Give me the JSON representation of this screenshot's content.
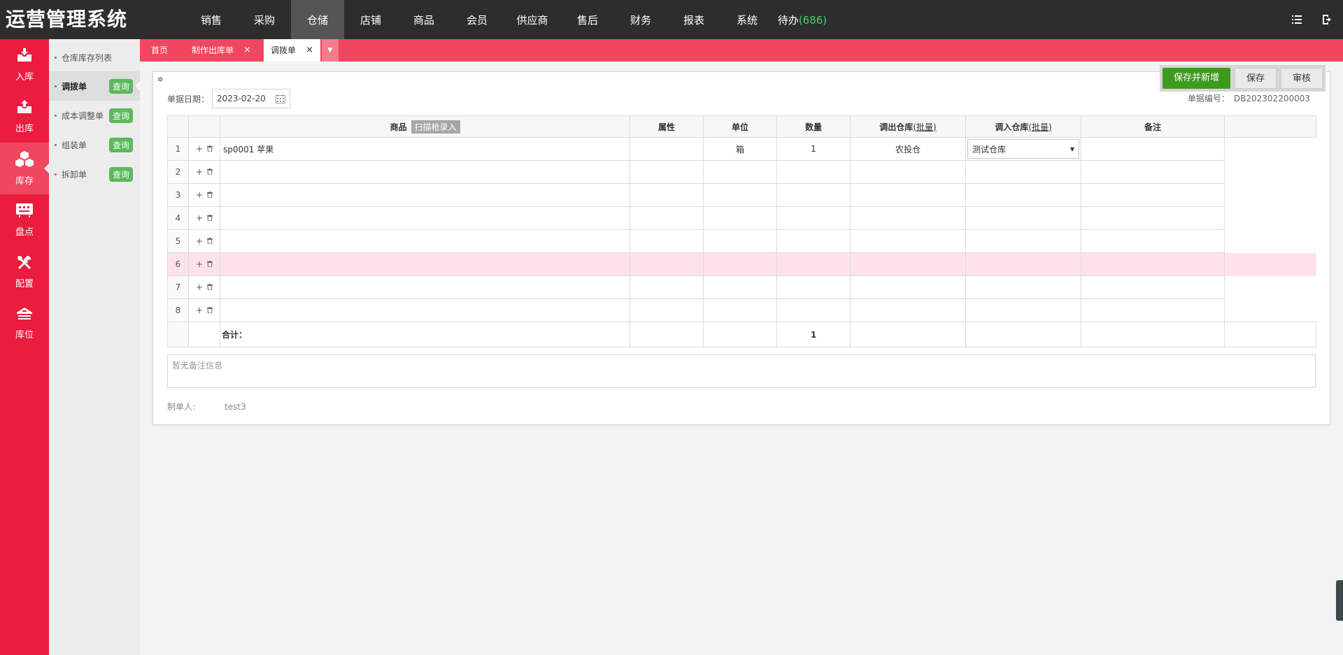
{
  "app": {
    "title": "运营管理系统"
  },
  "topnav": [
    {
      "label": "销售"
    },
    {
      "label": "采购"
    },
    {
      "label": "仓储",
      "active": true
    },
    {
      "label": "店铺"
    },
    {
      "label": "商品"
    },
    {
      "label": "会员"
    },
    {
      "label": "供应商"
    },
    {
      "label": "售后"
    },
    {
      "label": "财务"
    },
    {
      "label": "报表"
    },
    {
      "label": "系统"
    }
  ],
  "todo": {
    "label": "待办",
    "count": "(686)"
  },
  "sidebar": [
    {
      "label": "入库",
      "icon": "inbox-in-icon"
    },
    {
      "label": "出库",
      "icon": "inbox-out-icon"
    },
    {
      "label": "库存",
      "icon": "boxes-icon",
      "active": true
    },
    {
      "label": "盘点",
      "icon": "count-icon"
    },
    {
      "label": "配置",
      "icon": "tools-icon"
    },
    {
      "label": "库位",
      "icon": "warehouse-icon"
    }
  ],
  "submenu": [
    {
      "label": "仓库库存列表"
    },
    {
      "label": "调拨单",
      "tag": "查询",
      "active": true
    },
    {
      "label": "成本调整单",
      "tag": "查询"
    },
    {
      "label": "组装单",
      "tag": "查询"
    },
    {
      "label": "拆卸单",
      "tag": "查询"
    }
  ],
  "tabs": [
    {
      "label": "首页"
    },
    {
      "label": "制作出库单",
      "close": "×"
    },
    {
      "label": "调拨单",
      "close": "×",
      "active": true
    }
  ],
  "form": {
    "date_label": "单据日期：",
    "date_value": "2023-02-20",
    "docno_label": "单据编号：",
    "docno_value": "DB202302200003",
    "buttons": {
      "save_new": "保存并新增",
      "save": "保存",
      "audit": "审核"
    }
  },
  "grid": {
    "headers": {
      "product": "商品",
      "scan": "扫描枪录入",
      "attr": "属性",
      "unit": "单位",
      "qty": "数量",
      "out_wh": "调出仓库",
      "in_wh": "调入仓库",
      "batch": "(批量)",
      "remark": "备注"
    },
    "rows": [
      {
        "no": "1",
        "product": "sp0001 苹果",
        "attr": "",
        "unit": "箱",
        "qty": "1",
        "out_wh": "农投仓",
        "in_wh": "测试仓库",
        "remark": ""
      },
      {
        "no": "2",
        "product": "",
        "attr": "",
        "unit": "",
        "qty": "",
        "out_wh": "",
        "in_wh": "",
        "remark": ""
      },
      {
        "no": "3",
        "product": "",
        "attr": "",
        "unit": "",
        "qty": "",
        "out_wh": "",
        "in_wh": "",
        "remark": ""
      },
      {
        "no": "4",
        "product": "",
        "attr": "",
        "unit": "",
        "qty": "",
        "out_wh": "",
        "in_wh": "",
        "remark": ""
      },
      {
        "no": "5",
        "product": "",
        "attr": "",
        "unit": "",
        "qty": "",
        "out_wh": "",
        "in_wh": "",
        "remark": ""
      },
      {
        "no": "6",
        "product": "",
        "attr": "",
        "unit": "",
        "qty": "",
        "out_wh": "",
        "in_wh": "",
        "remark": ""
      },
      {
        "no": "7",
        "product": "",
        "attr": "",
        "unit": "",
        "qty": "",
        "out_wh": "",
        "in_wh": "",
        "remark": ""
      },
      {
        "no": "8",
        "product": "",
        "attr": "",
        "unit": "",
        "qty": "",
        "out_wh": "",
        "in_wh": "",
        "remark": ""
      }
    ],
    "highlighted_row": "6",
    "total_label": "合计：",
    "total_qty": "1"
  },
  "remark_placeholder": "暂无备注信息",
  "maker": {
    "label": "制单人:",
    "value": "test3"
  },
  "colors": {
    "topbar": "#2d2d2d",
    "sidebar": "#eb1c3d",
    "tabsbar": "#f0465f",
    "save_green": "#3e9a1f",
    "tag_green": "#5cb85c",
    "todo_count": "#4bd06a"
  }
}
